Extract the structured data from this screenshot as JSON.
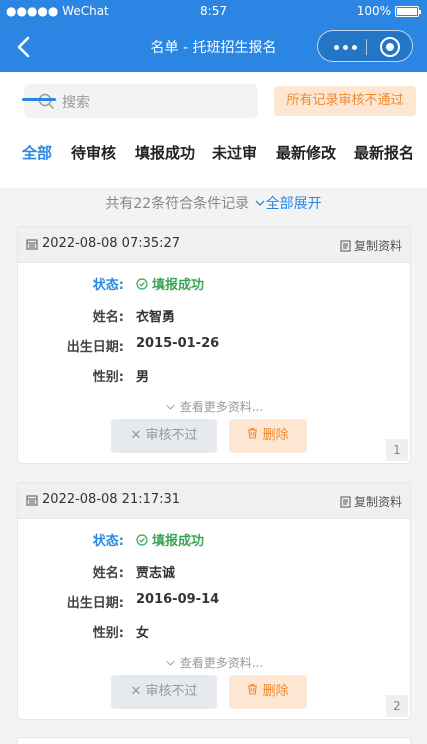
{
  "statusbar": {
    "carrier": "●●●●● WeChat",
    "time": "8:57",
    "battery": "100%"
  },
  "navbar": {
    "title": "名单 - 托班招生报名"
  },
  "search": {
    "placeholder": "搜索",
    "reject_all_label": "所有记录审核不通过"
  },
  "tabs": [
    {
      "label": "全部",
      "active": true
    },
    {
      "label": "待审核",
      "active": false
    },
    {
      "label": "填报成功",
      "active": false
    },
    {
      "label": "未过审",
      "active": false
    },
    {
      "label": "最新修改",
      "active": false
    },
    {
      "label": "最新报名",
      "active": false
    }
  ],
  "summary": {
    "text": "共有22条符合条件记录",
    "expand": "全部展开"
  },
  "labels": {
    "status": "状态:",
    "name": "姓名:",
    "birth": "出生日期:",
    "gender": "性别:",
    "copy": "复制资料",
    "more": "查看更多资料...",
    "reject_button": "审核不过",
    "delete_button": "删除"
  },
  "records": [
    {
      "datetime": "2022-08-08 07:35:27",
      "status": "填报成功",
      "name": "衣智勇",
      "birth": "2015-01-26",
      "gender": "男",
      "index": "1"
    },
    {
      "datetime": "2022-08-08 21:17:31",
      "status": "填报成功",
      "name": "贾志诚",
      "birth": "2016-09-14",
      "gender": "女",
      "index": "2"
    }
  ],
  "colors": {
    "primary": "#2b86e3",
    "success": "#3aa655",
    "warning": "#f08a2c"
  }
}
